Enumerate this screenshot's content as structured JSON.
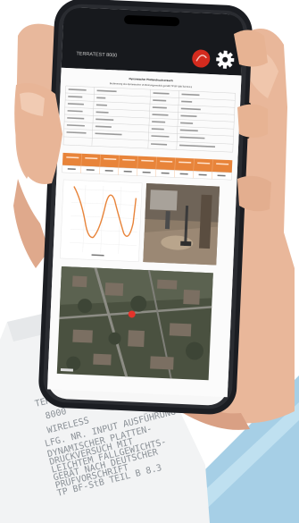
{
  "app": {
    "header_title": "TERRATEST 8000",
    "report_title": "Dynamischer Plattendruckversuch",
    "report_subtitle": "Bestimmung des dynamischen Verformungsmoduls gemäß TP BF-StB Teil B 8.3",
    "icons": [
      "record-icon",
      "gear-icon"
    ]
  },
  "table": {
    "header_color": "#e8843a",
    "header_count": 9
  },
  "receipt": {
    "lines": [
      "TERRATEST",
      "8000",
      "WIRELESS"
    ],
    "fine_print": [
      "LFG. NR.   INPUT  AUSFÜHRUNG",
      "DYNAMISCHER PLATTEN-",
      "DRUCKVERSUCH MIT",
      "LEICHTEM FALLGEWICHTS-",
      "GERÄT NACH DEUTSCHER",
      "PRÜFVORSCHRIFT",
      "TP BF-StB TEIL B 8.3"
    ]
  },
  "colors": {
    "phone_body": "#1b1d22",
    "accent": "#e8843a",
    "record_button": "#d42b1e",
    "background_blue": "#a6cfe6"
  }
}
